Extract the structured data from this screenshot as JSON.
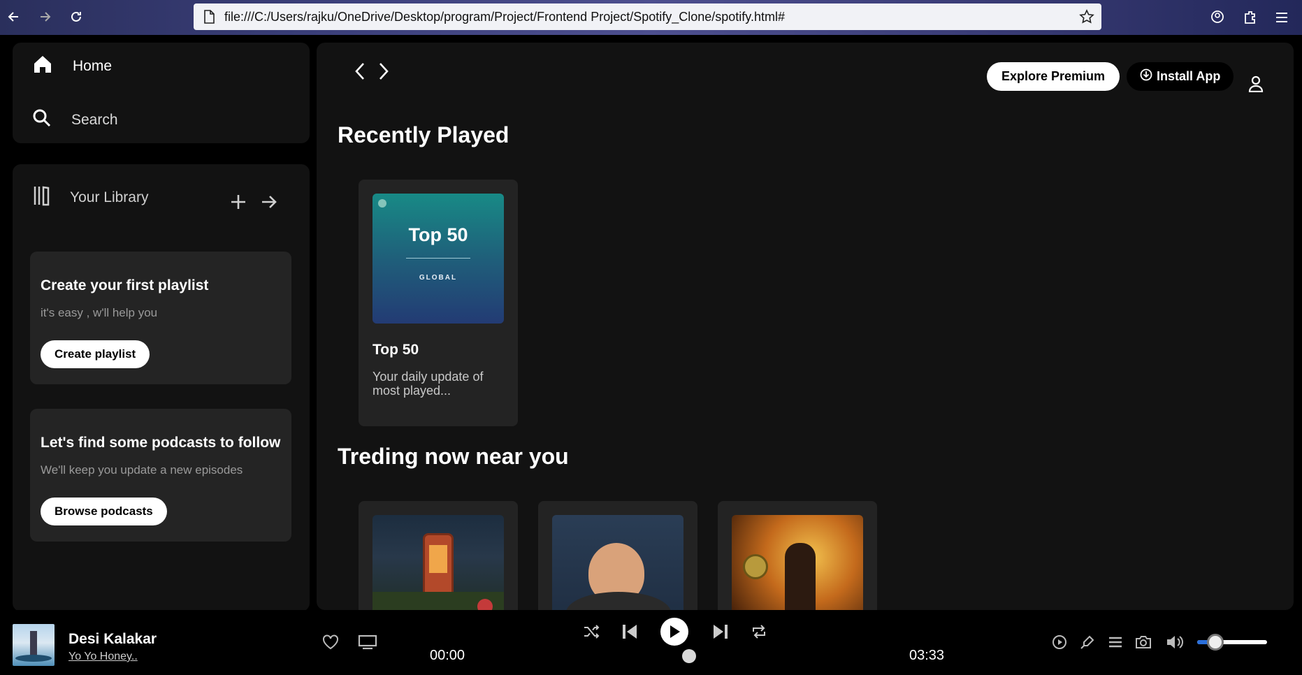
{
  "browser": {
    "url": "file:///C:/Users/rajku/OneDrive/Desktop/program/Project/Frontend Project/Spotify_Clone/spotify.html#"
  },
  "sidebar": {
    "home_label": "Home",
    "search_label": "Search",
    "library_label": "Your Library",
    "playlist_box": {
      "title": "Create your first playlist",
      "subtitle": "it's easy , w'll help you",
      "button": "Create playlist"
    },
    "podcast_box": {
      "title": "Let's find some podcasts to follow",
      "subtitle": "We'll keep you update a new episodes",
      "button": "Browse podcasts"
    }
  },
  "header": {
    "premium_label": "Explore Premium",
    "install_label": "Install App"
  },
  "main": {
    "recent_title": "Recently Played",
    "recent_cards": [
      {
        "cover_title": "Top 50",
        "cover_sub": "GLOBAL",
        "title": "Top 50",
        "desc": "Your daily update of most played..."
      }
    ],
    "trending_title": "Treding now near you"
  },
  "player": {
    "song_title": "Desi Kalakar",
    "artist": "Yo Yo Honey..",
    "current_time": "00:00",
    "total_time": "03:33",
    "volume_fraction": 0.25
  },
  "colors": {
    "panel": "#121212",
    "card": "#242424",
    "accent_volume": "#2a6fdb"
  }
}
